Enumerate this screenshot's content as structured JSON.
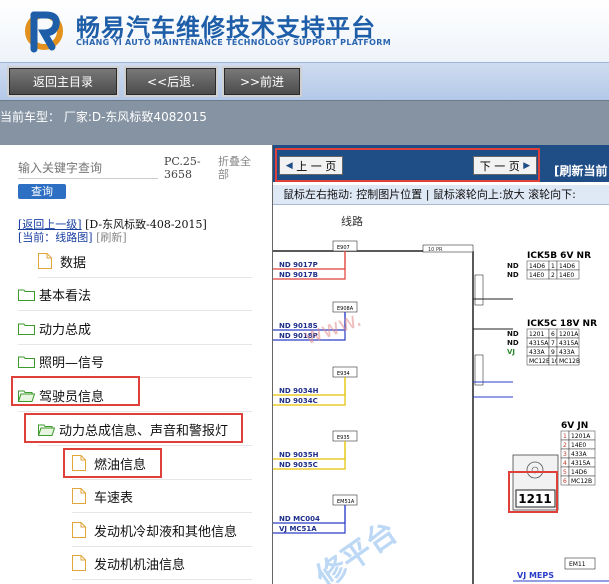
{
  "header": {
    "title": "畅易汽车维修技术支持平台",
    "subtitle": "CHANG YI AUTO MAINTENANCE TECHNOLOGY SUPPORT PLATFORM"
  },
  "toolbar": {
    "home_label": "返回主目录",
    "back_label": "<<后退.",
    "forward_label": ">>前进"
  },
  "car_bar": {
    "text": "当前车型：   厂家:D-东风标致4082015"
  },
  "search": {
    "placeholder": "输入关键字查询",
    "button_label": "查询",
    "pc_label": "PC.25-3658",
    "collapse_label": "折叠全部"
  },
  "nav": {
    "back_link": "[返回上一级]",
    "vehicle": "[D-东风标致-408-2015]",
    "current": "[当前：线路图]",
    "refresh": "[刷新]"
  },
  "tree": [
    {
      "label": "数据",
      "type": "doc"
    },
    {
      "label": "基本看法",
      "type": "folder"
    },
    {
      "label": "动力总成",
      "type": "folder"
    },
    {
      "label": "照明—信号",
      "type": "folder"
    },
    {
      "label": "驾驶员信息",
      "type": "folder-open"
    },
    {
      "label": "动力总成信息、声音和警报灯",
      "type": "folder-open"
    },
    {
      "label": "燃油信息",
      "type": "doc"
    },
    {
      "label": "车速表",
      "type": "doc"
    },
    {
      "label": "发动机冷却液和其他信息",
      "type": "doc"
    },
    {
      "label": "发动机机油信息",
      "type": "doc"
    }
  ],
  "viewer": {
    "prev_label": "上 一 页",
    "next_label": "下 一 页",
    "refresh_current": "[刷新当前",
    "hint": "鼠标左右拖动: 控制图片位置 | 鼠标滚轮向上:放大  滚轮向下:"
  },
  "diagram": {
    "title": "线路",
    "watermark": "www.",
    "watermark_cn": "修平台",
    "top_label": "10 PR",
    "connectors": [
      {
        "id": "E907",
        "wires": [
          "ND 9017P",
          "ND 9017B"
        ]
      },
      {
        "id": "E908A",
        "wires": [
          "ND 9018S",
          "ND 9018P"
        ]
      },
      {
        "id": "E934",
        "wires": [
          "ND 9034H",
          "ND 9034C"
        ]
      },
      {
        "id": "E935",
        "wires": [
          "ND 9035H",
          "ND 9035C"
        ]
      },
      {
        "id": "EM51A",
        "wires": [
          "ND MC004",
          "VJ MC51A"
        ]
      }
    ],
    "blocks": [
      {
        "title": "ICK5B  6V NR",
        "rows": [
          [
            "14D6",
            "1",
            "14D6"
          ],
          [
            "14E0",
            "2",
            "14E0"
          ]
        ],
        "left": [
          "ND",
          "ND"
        ]
      },
      {
        "title": "ICK5C  18V NR",
        "rows": [
          [
            "1201",
            "6",
            "1201A"
          ],
          [
            "4315A",
            "7",
            "4315A"
          ],
          [
            "433A",
            "9",
            "433A"
          ],
          [
            "MC12B",
            "10",
            "MC12B"
          ]
        ],
        "left": [
          "ND",
          "ND",
          "VJ",
          ""
        ]
      },
      {
        "title": "6V JN",
        "rows": [
          [
            "",
            "1",
            "1201A"
          ],
          [
            "",
            "2",
            "14E0"
          ],
          [
            "",
            "3",
            "433A"
          ],
          [
            "",
            "4",
            "4315A"
          ],
          [
            "",
            "5",
            "14D6"
          ],
          [
            "",
            "6",
            "MC12B"
          ]
        ],
        "left": []
      }
    ],
    "component": "1211",
    "bottom_label": "VJ MEPS",
    "bottom_box": "EM11",
    "colors": {
      "red": "#e0403a",
      "blue": "#2a3cc8",
      "yellow": "#e6c200"
    }
  }
}
